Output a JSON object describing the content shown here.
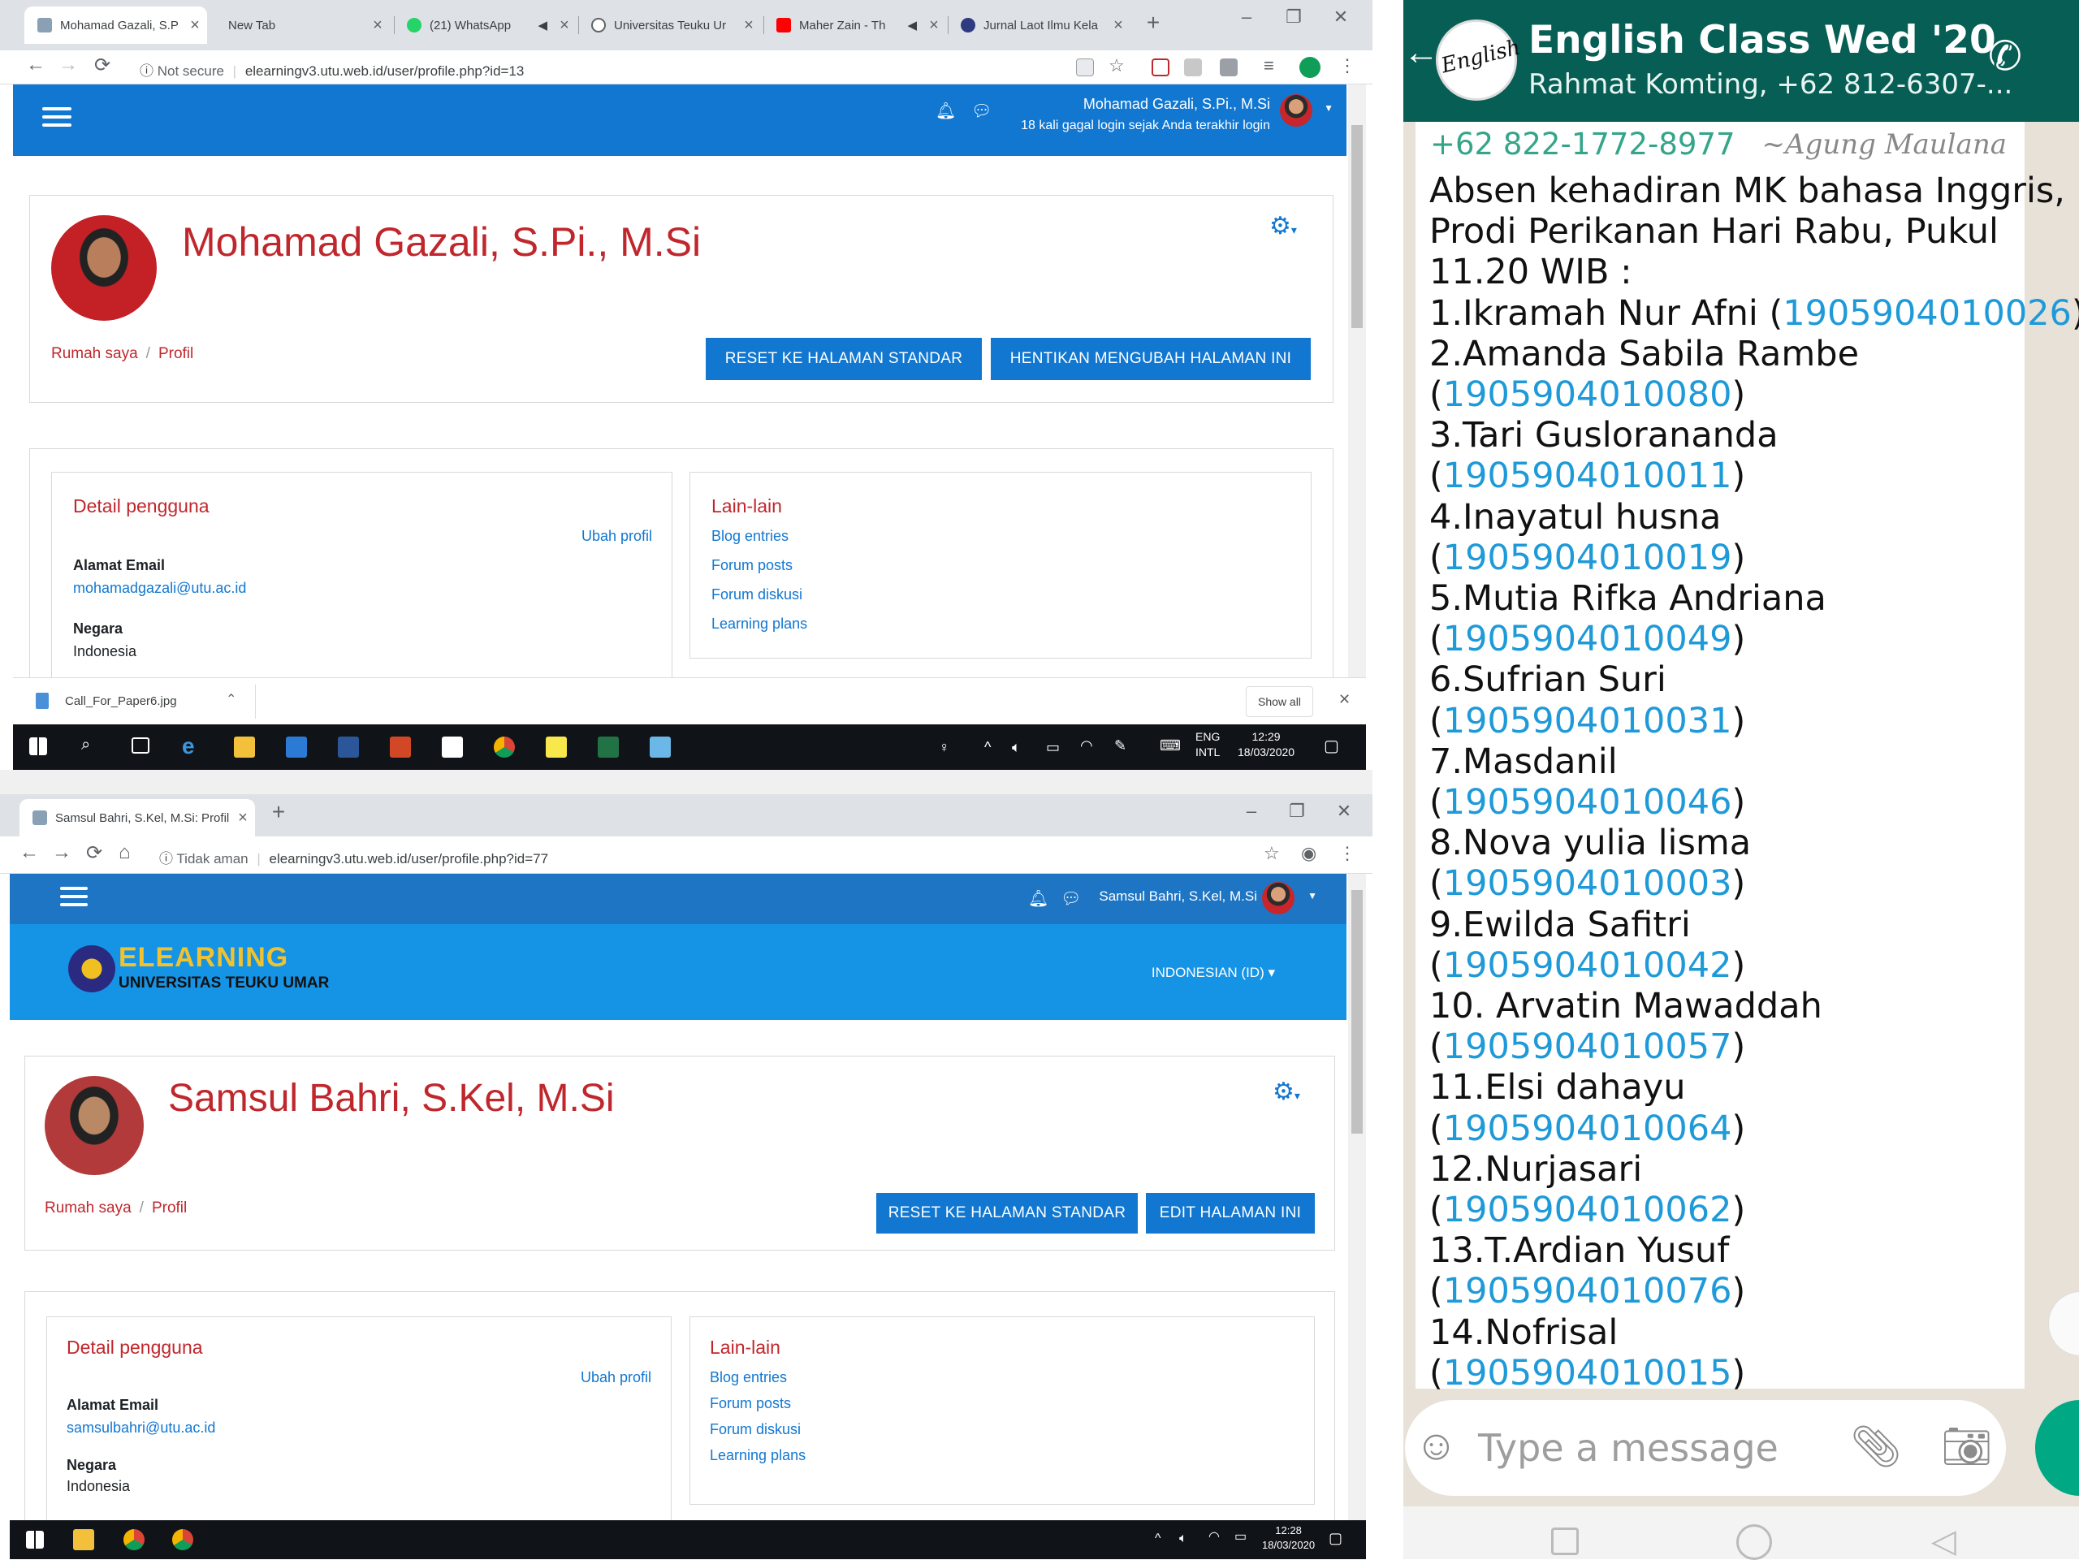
{
  "win1": {
    "tabs": [
      {
        "label": "Mohamad Gazali, S.P"
      },
      {
        "label": "New Tab"
      },
      {
        "label": "(21) WhatsApp"
      },
      {
        "label": "Universitas Teuku Ur"
      },
      {
        "label": "Maher Zain - Th"
      },
      {
        "label": "Jurnal Laot Ilmu Kela"
      }
    ],
    "address": {
      "not_secure": "Not secure",
      "url": "elearningv3.utu.web.id/user/profile.php?id=13"
    },
    "user_name": "Mohamad Gazali, S.Pi., M.Si",
    "login_warning": "18 kali gagal login sejak Anda terakhir login",
    "profile_name": "Mohamad Gazali, S.Pi., M.Si",
    "breadcrumb": {
      "home": "Rumah saya",
      "sep": "/",
      "current": "Profil"
    },
    "buttons": {
      "reset": "RESET KE HALAMAN STANDAR",
      "stop": "HENTIKAN MENGUBAH HALAMAN INI"
    },
    "detail": {
      "title": "Detail pengguna",
      "edit": "Ubah profil",
      "email_label": "Alamat Email",
      "email": "mohamadgazali@utu.ac.id",
      "country_label": "Negara",
      "country": "Indonesia"
    },
    "other": {
      "title": "Lain-lain",
      "links": [
        "Blog entries",
        "Forum posts",
        "Forum diskusi",
        "Learning plans"
      ]
    },
    "download": {
      "file": "Call_For_Paper6.jpg",
      "show_all": "Show all"
    },
    "taskbar": {
      "lang1": "ENG",
      "lang2": "INTL",
      "time": "12:29",
      "date": "18/03/2020"
    }
  },
  "win2": {
    "tab": "Samsul Bahri, S.Kel, M.Si: Profil P",
    "address": {
      "not_secure": "Tidak aman",
      "url": "elearningv3.utu.web.id/user/profile.php?id=77"
    },
    "user_name": "Samsul Bahri, S.Kel, M.Si",
    "logo_title": "ELEARNING",
    "logo_sub": "UNIVERSITAS TEUKU UMAR",
    "language": "INDONESIAN (ID)",
    "profile_name": "Samsul Bahri, S.Kel, M.Si",
    "breadcrumb": {
      "home": "Rumah saya",
      "sep": "/",
      "current": "Profil"
    },
    "buttons": {
      "reset": "RESET KE HALAMAN STANDAR",
      "edit": "EDIT HALAMAN INI"
    },
    "detail": {
      "title": "Detail pengguna",
      "edit": "Ubah profil",
      "email_label": "Alamat Email",
      "email": "samsulbahri@utu.ac.id",
      "country_label": "Negara",
      "country": "Indonesia"
    },
    "other": {
      "title": "Lain-lain",
      "links": [
        "Blog entries",
        "Forum posts",
        "Forum diskusi",
        "Learning plans"
      ]
    },
    "taskbar": {
      "time": "12:28",
      "date": "18/03/2020"
    }
  },
  "whatsapp": {
    "group_title": "English Class Wed '20",
    "members": "Rahmat Komting, +62 812-6307-...",
    "sender_phone": "+62 822-1772-8977",
    "sender_name": "~Agung Maulana",
    "intro_lines": [
      "Absen kehadiran MK bahasa Inggris,",
      "Prodi Perikanan Hari Rabu, Pukul",
      "11.20 WIB :"
    ],
    "entries": [
      {
        "name": "1.Ikramah Nur Afni (",
        "id": "1905904010026",
        "end": ")"
      },
      {
        "name": "2.Amanda Sabila Rambe",
        "id": "1905904010080"
      },
      {
        "name": "3.Tari Guslorananda",
        "id": "1905904010011"
      },
      {
        "name": "4.Inayatul husna",
        "id": "1905904010019"
      },
      {
        "name": "5.Mutia Rifka Andriana",
        "id": "1905904010049"
      },
      {
        "name": "6.Sufrian Suri",
        "id": "1905904010031"
      },
      {
        "name": "7.Masdanil",
        "id": "1905904010046"
      },
      {
        "name": "8.Nova yulia lisma",
        "id": "1905904010003"
      },
      {
        "name": "9.Ewilda Safitri",
        "id": "1905904010042"
      },
      {
        "name": "10. Arvatin Mawaddah",
        "id": "1905904010057"
      },
      {
        "name": "11.Elsi dahayu",
        "id": "1905904010064"
      },
      {
        "name": "12.Nurjasari",
        "id": "1905904010062"
      },
      {
        "name": "13.T.Ardian Yusuf",
        "id": "1905904010076"
      },
      {
        "name": "14.Nofrisal",
        "id": "1905904010015"
      }
    ],
    "input_placeholder": "Type a message"
  }
}
